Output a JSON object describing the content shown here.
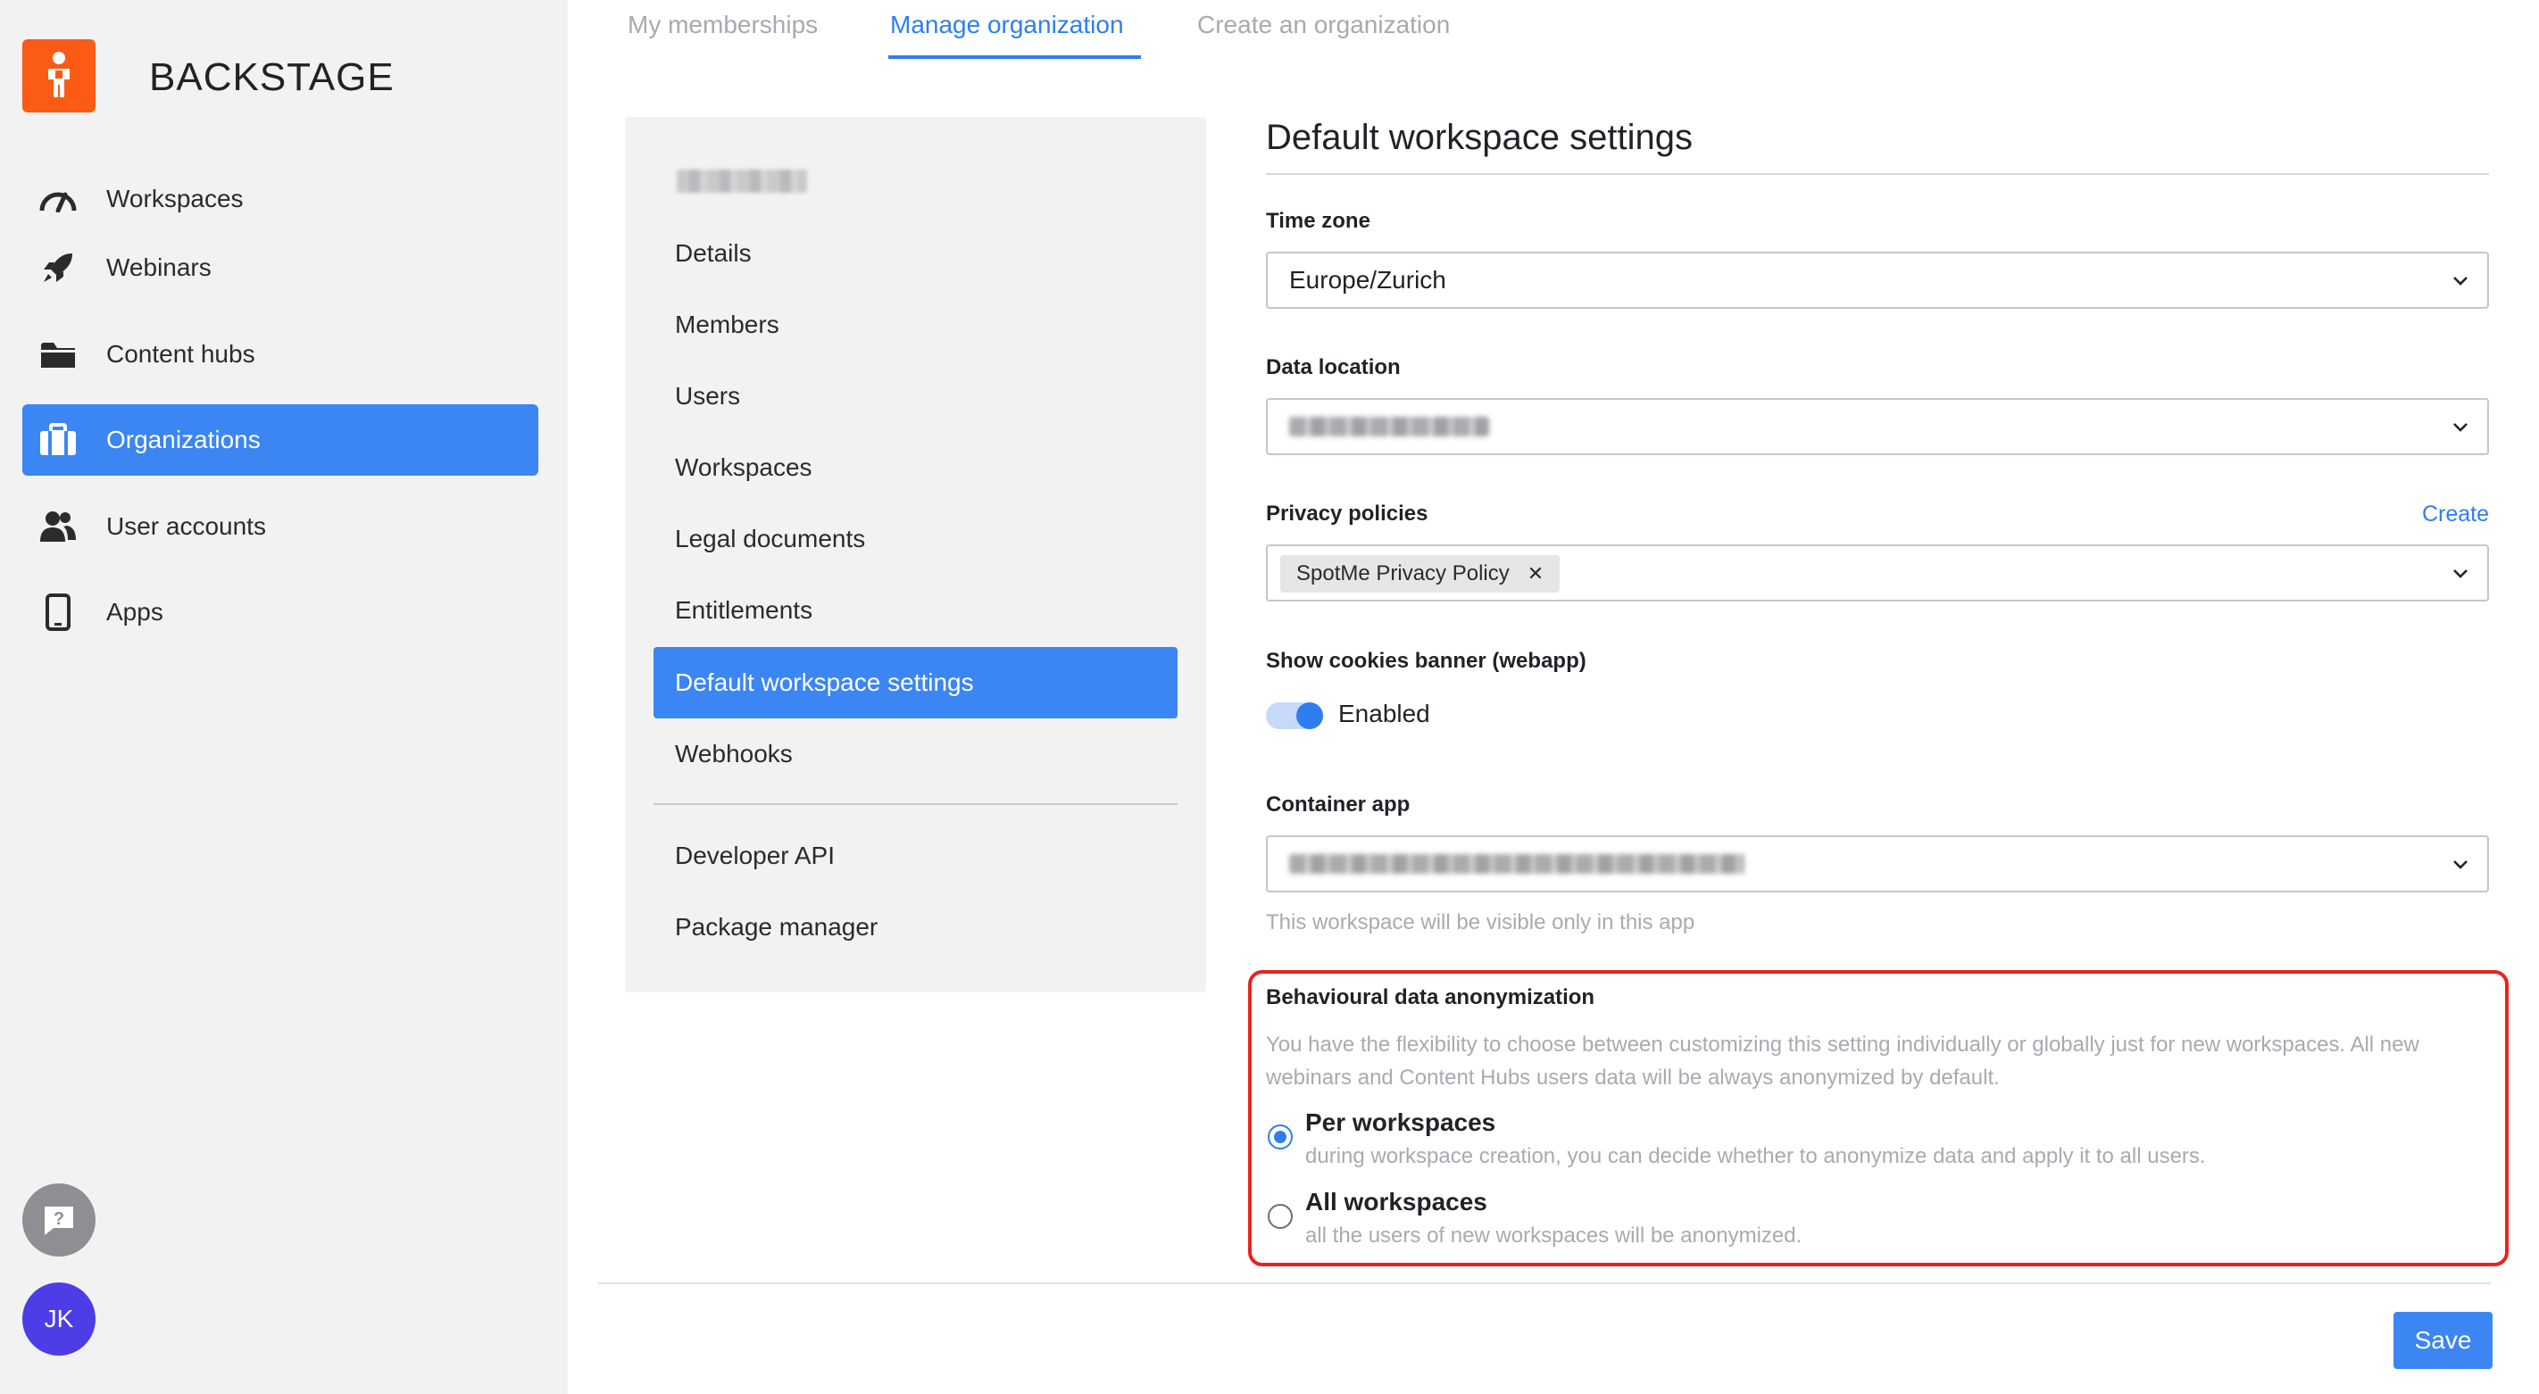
{
  "brand": {
    "name": "BACKSTAGE",
    "logo_color": "#fb5b15"
  },
  "sidebar": {
    "items": [
      {
        "label": "Workspaces",
        "icon": "gauge-icon"
      },
      {
        "label": "Webinars",
        "icon": "rocket-icon"
      },
      {
        "label": "Content hubs",
        "icon": "folder-icon"
      },
      {
        "label": "Organizations",
        "icon": "briefcase-icon",
        "active": true
      },
      {
        "label": "User accounts",
        "icon": "users-icon"
      },
      {
        "label": "Apps",
        "icon": "phone-icon"
      }
    ],
    "avatar_initials": "JK"
  },
  "tabs": [
    {
      "label": "My memberships"
    },
    {
      "label": "Manage organization",
      "active": true
    },
    {
      "label": "Create an organization"
    }
  ],
  "settings_nav": {
    "items": [
      {
        "label": "Details"
      },
      {
        "label": "Members"
      },
      {
        "label": "Users"
      },
      {
        "label": "Workspaces"
      },
      {
        "label": "Legal documents"
      },
      {
        "label": "Entitlements"
      },
      {
        "label": "Default workspace settings",
        "active": true
      },
      {
        "label": "Webhooks"
      }
    ],
    "extra_items": [
      {
        "label": "Developer API"
      },
      {
        "label": "Package manager"
      }
    ]
  },
  "form": {
    "title": "Default workspace settings",
    "time_zone": {
      "label": "Time zone",
      "value": "Europe/Zurich"
    },
    "data_location": {
      "label": "Data location"
    },
    "privacy_policies": {
      "label": "Privacy policies",
      "create_label": "Create",
      "tags": [
        "SpotMe Privacy Policy"
      ]
    },
    "cookies_banner": {
      "label": "Show cookies banner (webapp)",
      "state_label": "Enabled",
      "enabled": true
    },
    "container_app": {
      "label": "Container app",
      "hint": "This workspace will be visible only in this app"
    },
    "anonymization": {
      "label": "Behavioural data anonymization",
      "description": "You have the flexibility to choose between customizing this setting individually or globally just for new workspaces. All new webinars and Content Hubs users data will be always anonymized by default.",
      "options": [
        {
          "title": "Per workspaces",
          "description": "during workspace creation, you can decide whether to anonymize data and apply it to all users.",
          "selected": true
        },
        {
          "title": "All workspaces",
          "description": "all the users of new workspaces will be anonymized.",
          "selected": false
        }
      ]
    },
    "save_label": "Save"
  },
  "colors": {
    "accent": "#3b86f2",
    "highlight": "#e8231e",
    "avatar": "#4d3de6"
  }
}
